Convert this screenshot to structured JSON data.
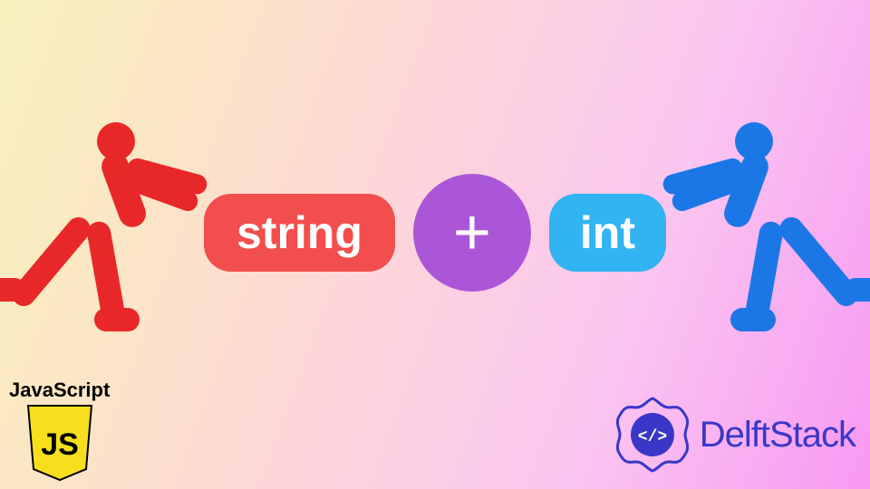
{
  "diagram": {
    "left_operand": "string",
    "operator": "+",
    "right_operand": "int"
  },
  "badges": {
    "js_label": "JavaScript",
    "js_shield_text": "JS",
    "delftstack": "DelftStack",
    "delft_mark": "</>"
  },
  "colors": {
    "figure_left": "#e82828",
    "figure_right": "#1c77e6",
    "pill_left": "#f34e4e",
    "pill_right": "#32b3f2",
    "plus_circle": "#ab56d8",
    "delft_text": "#3a37c8",
    "js_shield": "#f7df1e"
  }
}
